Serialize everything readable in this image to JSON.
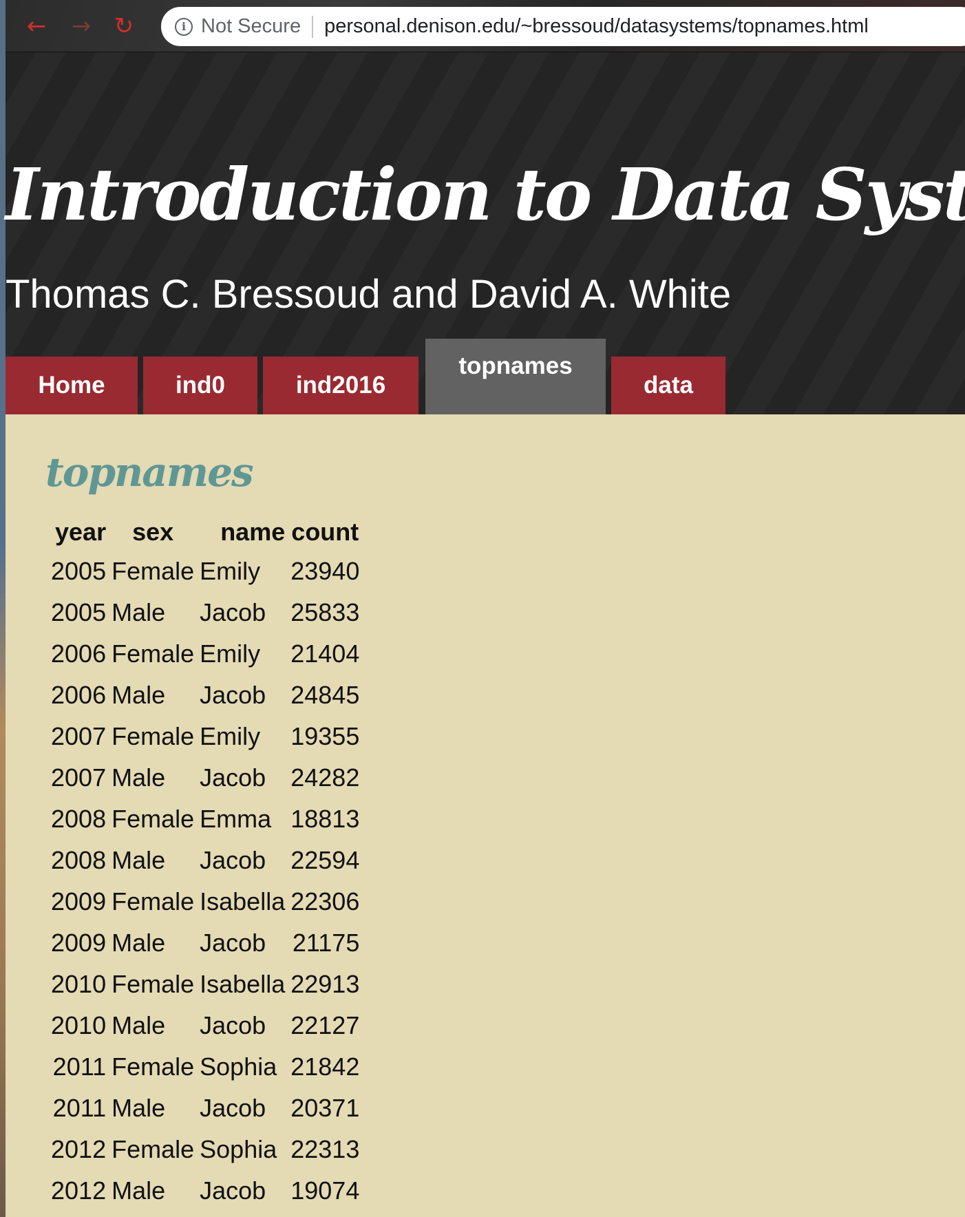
{
  "browser": {
    "security_label": "Not Secure",
    "url": "personal.denison.edu/~bressoud/datasystems/topnames.html"
  },
  "header": {
    "title": "Introduction to Data Systems",
    "authors": "Thomas C. Bressoud and David A. White"
  },
  "nav": {
    "tabs": [
      {
        "label": "Home"
      },
      {
        "label": "ind0"
      },
      {
        "label": "ind2016"
      },
      {
        "label": "topnames",
        "active": true
      },
      {
        "label": "data"
      }
    ]
  },
  "main": {
    "heading": "topnames",
    "table": {
      "columns": [
        "year",
        "sex",
        "name",
        "count"
      ],
      "rows": [
        [
          "2005",
          "Female",
          "Emily",
          "23940"
        ],
        [
          "2005",
          "Male",
          "Jacob",
          "25833"
        ],
        [
          "2006",
          "Female",
          "Emily",
          "21404"
        ],
        [
          "2006",
          "Male",
          "Jacob",
          "24845"
        ],
        [
          "2007",
          "Female",
          "Emily",
          "19355"
        ],
        [
          "2007",
          "Male",
          "Jacob",
          "24282"
        ],
        [
          "2008",
          "Female",
          "Emma",
          "18813"
        ],
        [
          "2008",
          "Male",
          "Jacob",
          "22594"
        ],
        [
          "2009",
          "Female",
          "Isabella",
          "22306"
        ],
        [
          "2009",
          "Male",
          "Jacob",
          "21175"
        ],
        [
          "2010",
          "Female",
          "Isabella",
          "22913"
        ],
        [
          "2010",
          "Male",
          "Jacob",
          "22127"
        ],
        [
          "2011",
          "Female",
          "Sophia",
          "21842"
        ],
        [
          "2011",
          "Male",
          "Jacob",
          "20371"
        ],
        [
          "2012",
          "Female",
          "Sophia",
          "22313"
        ],
        [
          "2012",
          "Male",
          "Jacob",
          "19074"
        ]
      ]
    }
  },
  "colors": {
    "header_bg": "#242424",
    "tab_bg": "#9a2a32",
    "tab_active_bg": "#626262",
    "content_bg": "#e4dab4",
    "heading_color": "#5f9795"
  },
  "icons": {
    "back": "arrow-left",
    "forward": "arrow-right",
    "reload": "reload",
    "site_info": "info-circle"
  }
}
